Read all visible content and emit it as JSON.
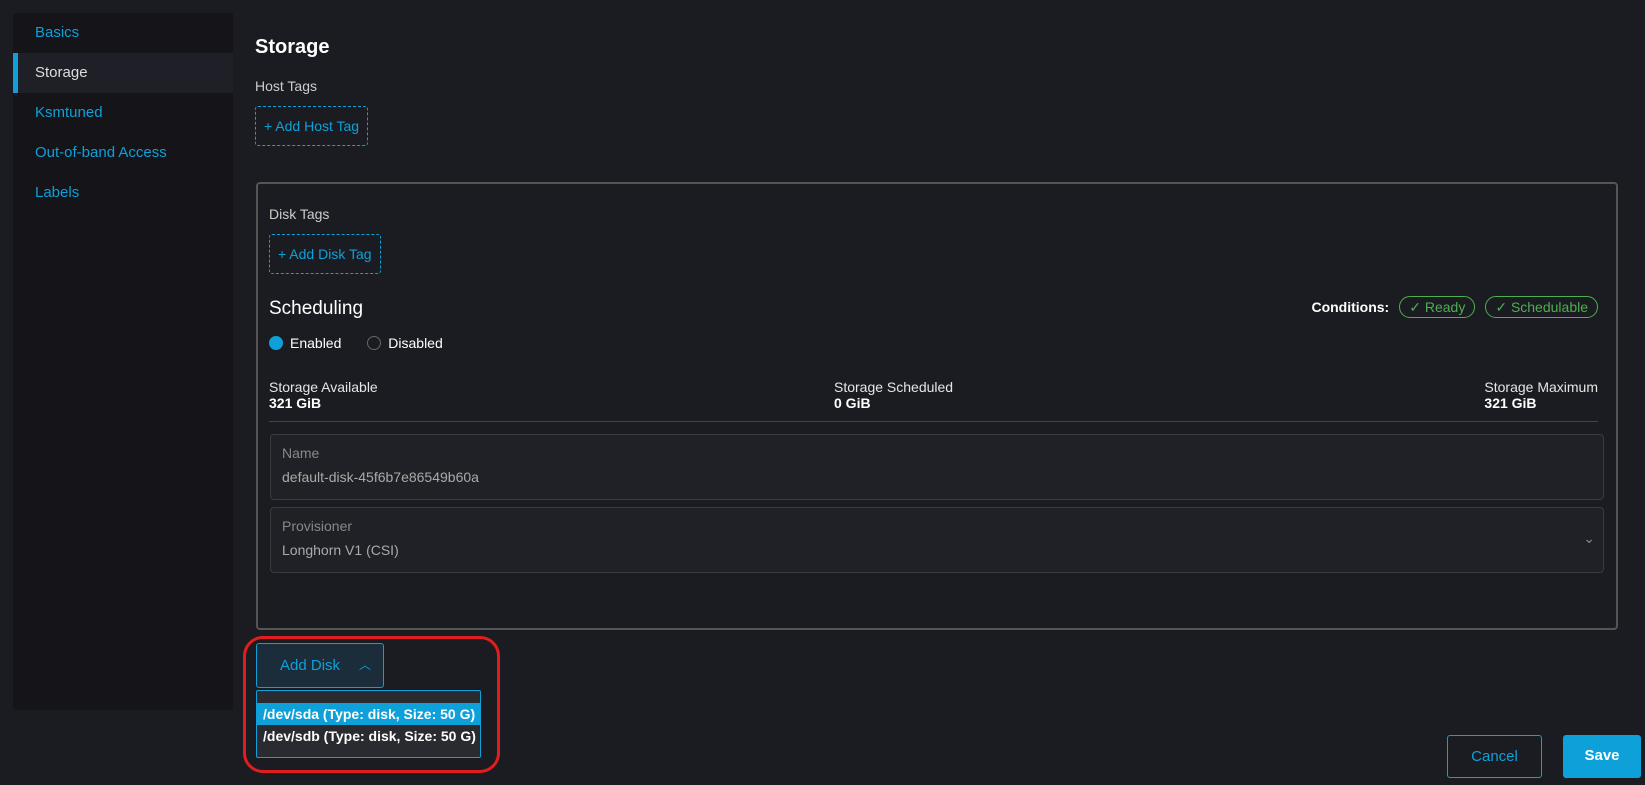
{
  "sidebar": {
    "items": [
      {
        "label": "Basics"
      },
      {
        "label": "Storage"
      },
      {
        "label": "Ksmtuned"
      },
      {
        "label": "Out-of-band Access"
      },
      {
        "label": "Labels"
      }
    ]
  },
  "page": {
    "title": "Storage",
    "host_tags_label": "Host Tags",
    "add_host_tag": "+ Add Host Tag"
  },
  "disk": {
    "disk_tags_label": "Disk Tags",
    "add_disk_tag": "+ Add Disk Tag",
    "scheduling_title": "Scheduling",
    "scheduling_options": [
      {
        "label": "Enabled",
        "selected": true
      },
      {
        "label": "Disabled",
        "selected": false
      }
    ],
    "conditions_label": "Conditions:",
    "conditions": [
      "Ready",
      "Schedulable"
    ],
    "stats": [
      {
        "label": "Storage Available",
        "value": "321 GiB"
      },
      {
        "label": "Storage Scheduled",
        "value": "0 GiB"
      },
      {
        "label": "Storage Maximum",
        "value": "321 GiB"
      }
    ],
    "name_label": "Name",
    "name_value": "default-disk-45f6b7e86549b60a",
    "provisioner_label": "Provisioner",
    "provisioner_value": "Longhorn V1 (CSI)"
  },
  "add_disk": {
    "label": "Add Disk",
    "options": [
      "/dev/sda (Type: disk, Size: 50 G)",
      "/dev/sdb (Type: disk, Size: 50 G)"
    ]
  },
  "footer": {
    "cancel": "Cancel",
    "save": "Save"
  },
  "colors": {
    "accent": "#0ea0d8",
    "success": "#4caf50",
    "highlight": "#e21d1d"
  }
}
